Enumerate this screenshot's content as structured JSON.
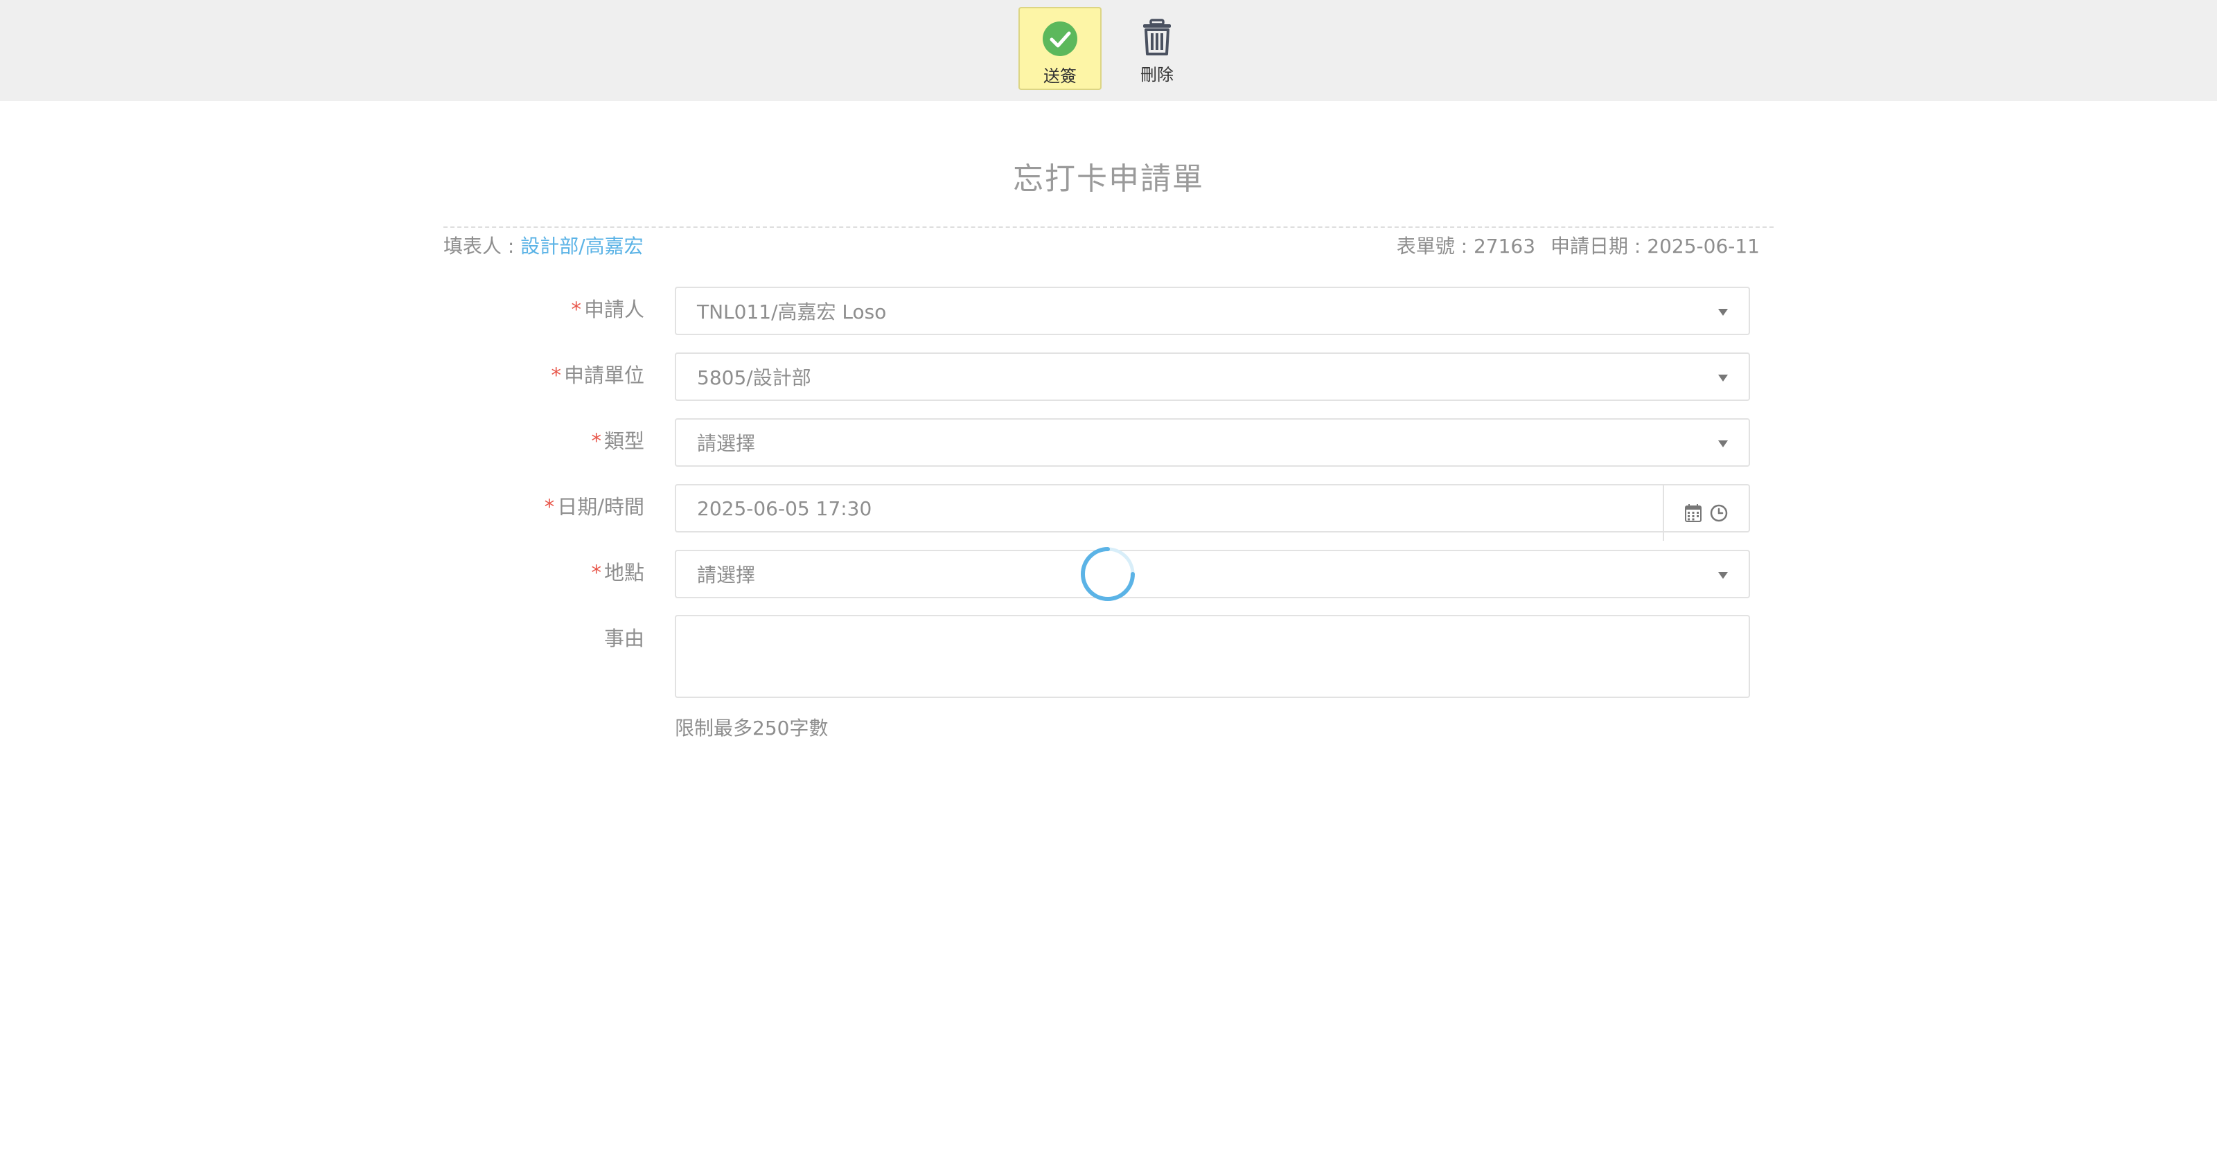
{
  "toolbar": {
    "submit_label": "送簽",
    "delete_label": "刪除",
    "submit_color": "#fdf5a6"
  },
  "form": {
    "title": "忘打卡申請單",
    "filler_label": "填表人 : ",
    "filler_value": "設計部/高嘉宏",
    "form_no_label": "表單號 : ",
    "form_no_value": "27163",
    "apply_date_label": "申請日期 : ",
    "apply_date_value": "2025-06-11"
  },
  "fields": {
    "applicant": {
      "label": "申請人",
      "value": "TNL011/高嘉宏 Loso"
    },
    "unit": {
      "label": "申請單位",
      "value": "5805/設計部"
    },
    "type": {
      "label": "類型",
      "value": "請選擇"
    },
    "datetime": {
      "label": "日期/時間",
      "value": "2025-06-05 17:30"
    },
    "location": {
      "label": "地點",
      "value": "請選擇"
    },
    "reason": {
      "label": "事由",
      "value": "",
      "hint": "限制最多250字數"
    }
  },
  "required_mark": "*",
  "colors": {
    "accent_link": "#5bb3e6",
    "required": "#e8564a",
    "spinner": "#5bb3e6",
    "check": "#5cb85c"
  }
}
